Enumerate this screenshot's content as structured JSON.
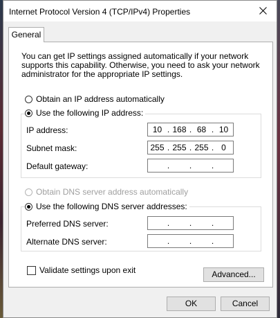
{
  "window": {
    "title": "Internet Protocol Version 4 (TCP/IPv4) Properties"
  },
  "tabs": [
    {
      "label": "General"
    }
  ],
  "description": "You can get IP settings assigned automatically if your network supports this capability. Otherwise, you need to ask your network administrator for the appropriate IP settings.",
  "ip": {
    "auto_label": "Obtain an IP address automatically",
    "manual_label": "Use the following IP address:",
    "selected": "manual",
    "address_label": "IP address:",
    "address": [
      "10",
      "168",
      "68",
      "10"
    ],
    "mask_label": "Subnet mask:",
    "mask": [
      "255",
      "255",
      "255",
      "0"
    ],
    "gateway_label": "Default gateway:",
    "gateway": [
      "",
      "",
      "",
      ""
    ]
  },
  "dns": {
    "auto_label": "Obtain DNS server address automatically",
    "manual_label": "Use the following DNS server addresses:",
    "selected": "manual",
    "preferred_label": "Preferred DNS server:",
    "preferred": [
      "",
      "",
      "",
      ""
    ],
    "alternate_label": "Alternate DNS server:",
    "alternate": [
      "",
      "",
      "",
      ""
    ]
  },
  "validate": {
    "label": "Validate settings upon exit",
    "checked": false
  },
  "buttons": {
    "advanced": "Advanced...",
    "ok": "OK",
    "cancel": "Cancel"
  },
  "dots": {
    "sep": "."
  }
}
